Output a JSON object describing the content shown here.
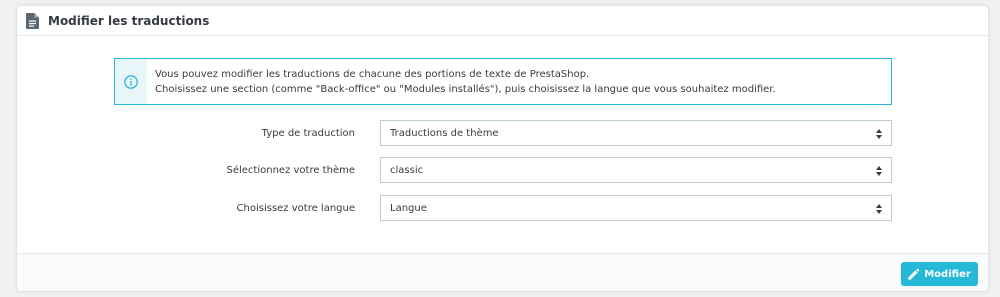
{
  "panel": {
    "title": "Modifier les traductions",
    "icon": "document-icon"
  },
  "alert": {
    "icon": "info-icon",
    "line1": "Vous pouvez modifier les traductions de chacune des portions de texte de PrestaShop.",
    "line2": "Choisissez une section (comme \"Back-office\" ou \"Modules installés\"), puis choisissez la langue que vous souhaitez modifier."
  },
  "form": {
    "fields": [
      {
        "label": "Type de traduction",
        "value": "Traductions de thème"
      },
      {
        "label": "Sélectionnez votre thème",
        "value": "classic"
      },
      {
        "label": "Choisissez votre langue",
        "value": "Langue"
      }
    ]
  },
  "footer": {
    "submit_label": "Modifier",
    "submit_icon": "pencil-icon"
  },
  "colors": {
    "accent": "#25b9d7",
    "text": "#363a41",
    "border": "#bbcdd2",
    "page_bg": "#eff1f2"
  }
}
